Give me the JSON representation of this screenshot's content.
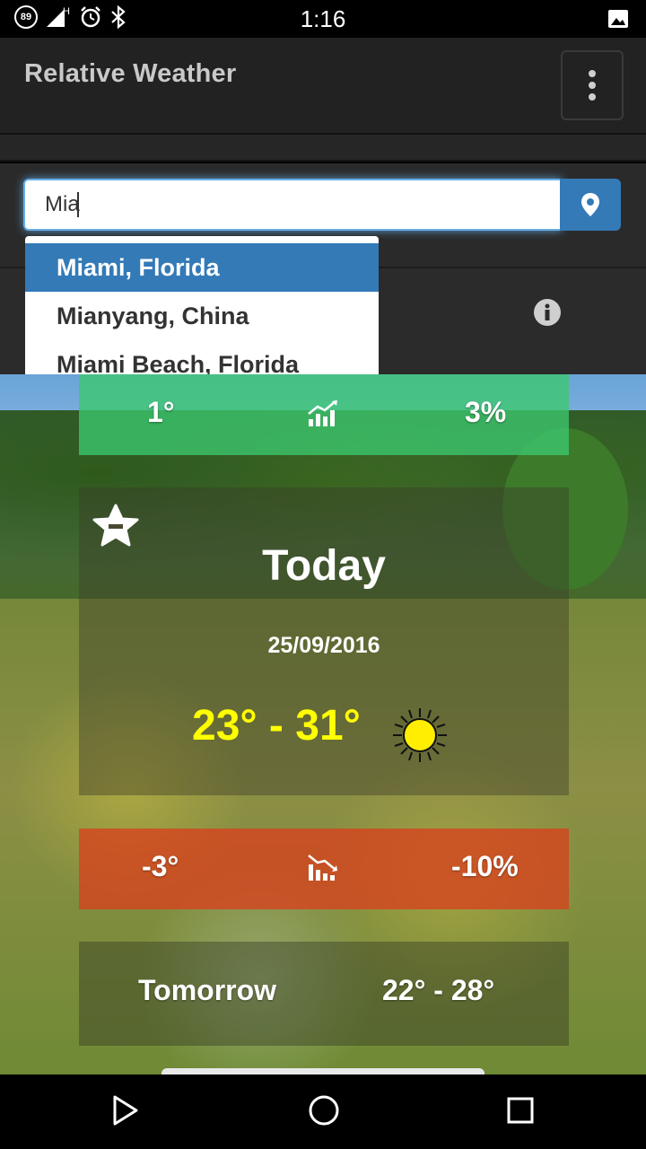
{
  "status_bar": {
    "badge": "89",
    "network": "H",
    "time": "1:16"
  },
  "app_bar": {
    "title": "Relative Weather",
    "menu_icon": "more-vert-icon"
  },
  "search": {
    "value": "Mia",
    "button_icon": "map-marker-icon"
  },
  "suggestions": [
    {
      "label": "Miami, Florida",
      "active": true
    },
    {
      "label": "Mianyang, China",
      "active": false
    },
    {
      "label": "Miami Beach, Florida",
      "active": false
    }
  ],
  "colors": {
    "accent": "#337ab7",
    "up_card": "#3cc86e",
    "down_card": "#d7411e",
    "temp_today": "#ffff00"
  },
  "comparison_up": {
    "degrees": "1°",
    "icon": "chart-up-icon",
    "percent": "3%"
  },
  "today": {
    "title": "Today",
    "date": "25/09/2016",
    "temp_range": "23° - 31°",
    "condition_icon": "sun-icon",
    "favorite_icon": "star-icon"
  },
  "comparison_down": {
    "degrees": "-3°",
    "icon": "chart-down-icon",
    "percent": "-10%"
  },
  "tomorrow": {
    "label": "Tomorrow",
    "temp_range": "22° - 28°"
  }
}
